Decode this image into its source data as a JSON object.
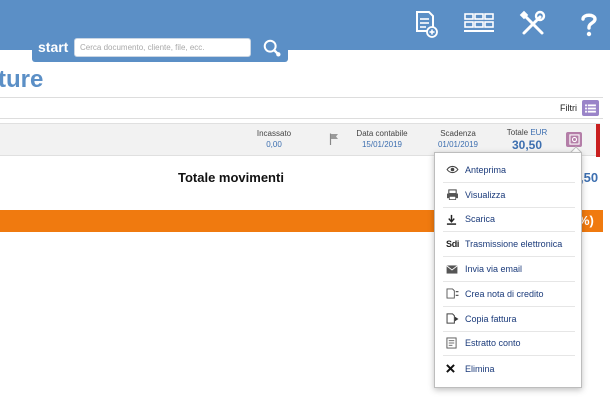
{
  "header": {
    "search_tab_label": "start",
    "search_placeholder": "Cerca documento, cliente, file, ecc.",
    "icons": [
      "new-document-icon",
      "grid-icon",
      "tools-icon",
      "help-icon"
    ]
  },
  "page": {
    "title": "ture"
  },
  "filter": {
    "label": "Filtri"
  },
  "document_row": {
    "incassato_label": "Incassato",
    "incassato_value": "0,00",
    "data_contabile_label": "Data contabile",
    "data_contabile_value": "15/01/2019",
    "scadenza_label": "Scadenza",
    "scadenza_value": "01/01/2019",
    "totale_label": "Totale",
    "totale_currency": "EUR",
    "totale_value": "30,50"
  },
  "movements": {
    "title": "Totale movimenti",
    "amount": ",50"
  },
  "orange_bar": {
    "text": "%)"
  },
  "menu": {
    "items": [
      {
        "label": "Anteprima",
        "icon": "eye-icon"
      },
      {
        "label": "Visualizza",
        "icon": "printer-icon"
      },
      {
        "label": "Scarica",
        "icon": "download-icon"
      },
      {
        "label": "Trasmissione elettronica",
        "icon": "sdi-icon",
        "icon_text": "Sdi"
      },
      {
        "label": "Invia via email",
        "icon": "envelope-icon"
      },
      {
        "label": "Crea nota di credito",
        "icon": "credit-note-icon"
      },
      {
        "label": "Copia fattura",
        "icon": "copy-invoice-icon"
      },
      {
        "label": "Estratto conto",
        "icon": "statement-icon"
      },
      {
        "label": "Elimina",
        "icon": "delete-icon"
      }
    ]
  },
  "colors": {
    "topbar": "#5b8fc6",
    "accent_blue": "#3d6fb0",
    "orange": "#f07a0f",
    "status_red": "#c91f1f",
    "filter_button": "#9a84c8",
    "action_button": "#b47ea8"
  }
}
